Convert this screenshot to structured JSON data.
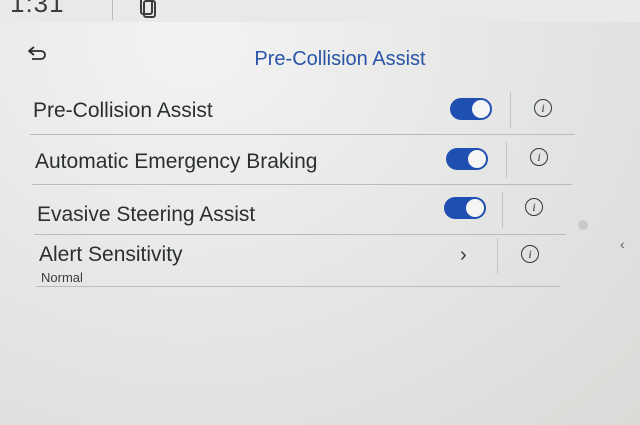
{
  "status_bar": {
    "time": "1:31",
    "phone_icon": "phone-projection-icon"
  },
  "header": {
    "back_icon": "back-arrow-icon",
    "title": "Pre-Collision Assist"
  },
  "settings": [
    {
      "label": "Pre-Collision Assist",
      "control": "toggle",
      "state": "on",
      "info_icon": "info-icon"
    },
    {
      "label": "Automatic Emergency Braking",
      "control": "toggle",
      "state": "on",
      "info_icon": "info-icon"
    },
    {
      "label": "Evasive Steering Assist",
      "control": "toggle",
      "state": "on",
      "info_icon": "info-icon"
    },
    {
      "label": "Alert Sensitivity",
      "value": "Normal",
      "control": "chevron",
      "info_icon": "info-icon"
    }
  ],
  "colors": {
    "accent": "#1f4fb0",
    "title": "#2a54a8",
    "background": "#e7e8e6"
  }
}
